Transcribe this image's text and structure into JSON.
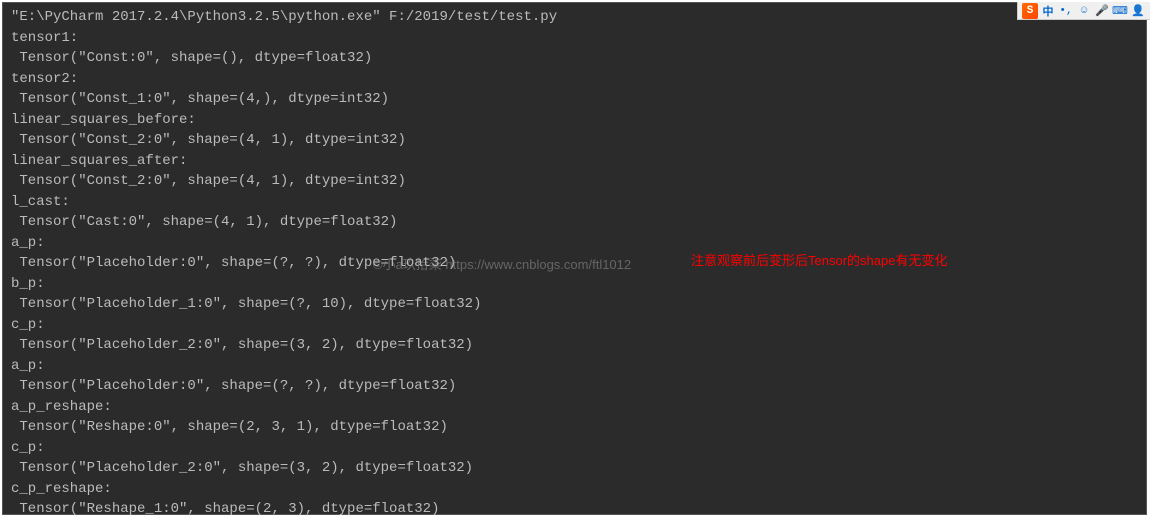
{
  "ime": {
    "sogou": "S",
    "zh": "中",
    "comma": "•,",
    "smile": "☺",
    "mic": "🎤",
    "keyboard": "⌨",
    "user": "👤"
  },
  "console": {
    "lines": [
      "\"E:\\PyCharm 2017.2.4\\Python3.2.5\\python.exe\" F:/2019/test/test.py",
      "tensor1:",
      " Tensor(\"Const:0\", shape=(), dtype=float32)",
      "tensor2:",
      " Tensor(\"Const_1:0\", shape=(4,), dtype=int32)",
      "linear_squares_before:",
      " Tensor(\"Const_2:0\", shape=(4, 1), dtype=int32)",
      "linear_squares_after:",
      " Tensor(\"Const_2:0\", shape=(4, 1), dtype=int32)",
      "l_cast:",
      " Tensor(\"Cast:0\", shape=(4, 1), dtype=float32)",
      "a_p:",
      " Tensor(\"Placeholder:0\", shape=(?, ?), dtype=float32)",
      "b_p:",
      " Tensor(\"Placeholder_1:0\", shape=(?, 10), dtype=float32)",
      "c_p:",
      " Tensor(\"Placeholder_2:0\", shape=(3, 2), dtype=float32)",
      "a_p:",
      " Tensor(\"Placeholder:0\", shape=(?, ?), dtype=float32)",
      "a_p_reshape:",
      " Tensor(\"Reshape:0\", shape=(2, 3, 1), dtype=float32)",
      "c_p:",
      " Tensor(\"Placeholder_2:0\", shape=(3, 2), dtype=float32)",
      "c_p_reshape:",
      " Tensor(\"Reshape_1:0\", shape=(2, 3), dtype=float32)"
    ]
  },
  "annotation": "注意观察前后变形后Tensor的shape有无变化",
  "watermark": "©小a玖拾柒  https://www.cnblogs.com/ftl1012"
}
